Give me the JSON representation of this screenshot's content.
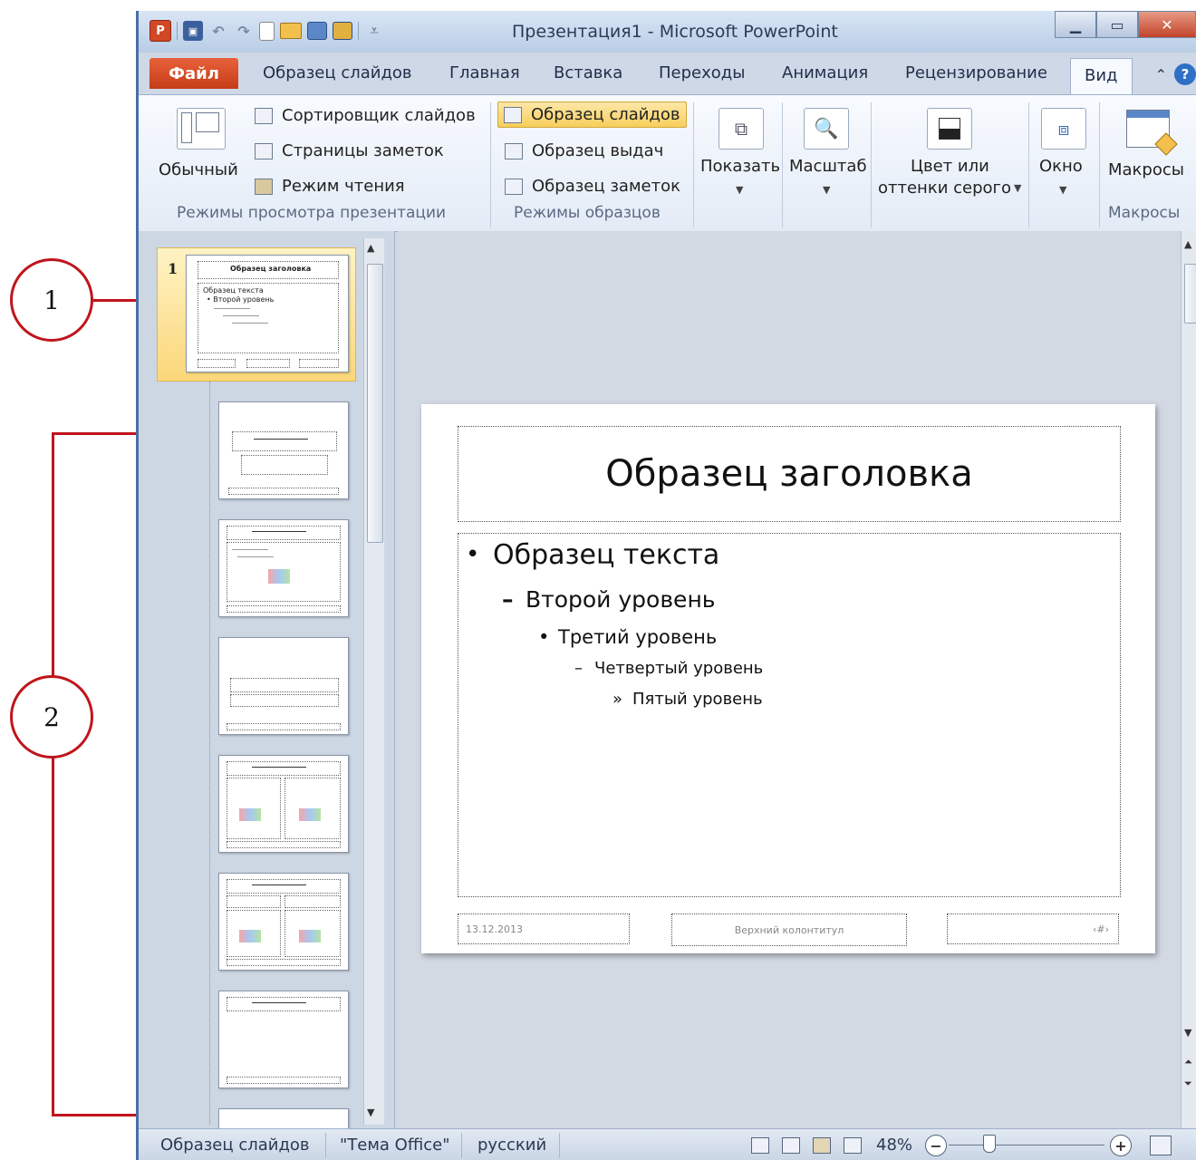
{
  "window": {
    "title": "Презентация1 - Microsoft PowerPoint",
    "app_icon_letter": "P",
    "controls": [
      "minimize-icon",
      "maximize-icon",
      "close-icon"
    ]
  },
  "ribbon_tabs": [
    "Файл",
    "Образец слайдов",
    "Главная",
    "Вставка",
    "Переходы",
    "Анимация",
    "Рецензирование",
    "Вид"
  ],
  "active_tab": "Вид",
  "ribbon": {
    "view_modes": {
      "normal": "Обычный",
      "sorter": "Сортировщик слайдов",
      "notes_pages": "Страницы заметок",
      "reading": "Режим чтения",
      "label": "Режимы просмотра презентации"
    },
    "master_views": {
      "slide_master": "Образец слайдов",
      "handout_master": "Образец выдач",
      "notes_master": "Образец заметок",
      "label": "Режимы образцов"
    },
    "show": "Показать",
    "zoom": "Масштаб",
    "color_line1": "Цвет или",
    "color_line2": "оттенки серого",
    "window_btn": "Окно",
    "macros": "Макросы",
    "macros_label": "Макросы"
  },
  "thumbnails": {
    "selected_number": "1",
    "master_title": "Образец заголовка",
    "master_body_1": "Образец текста",
    "master_body_2": "• Второй уровень"
  },
  "slide": {
    "title": "Образец заголовка",
    "levels": [
      "Образец текста",
      "Второй уровень",
      "Третий уровень",
      "Четвертый уровень",
      "Пятый уровень"
    ],
    "bullets": [
      "•",
      "–",
      "•",
      "–",
      "»"
    ],
    "footer_date": "13.12.2013",
    "footer_center": "Верхний колонтитул",
    "footer_num": "‹#›"
  },
  "status": {
    "view": "Образец слайдов",
    "theme": "\"Тема Office\"",
    "language": "русский",
    "zoom": "48%",
    "zoom_percent": 48
  },
  "callouts": [
    "1",
    "2"
  ],
  "colors": {
    "accent_file": "#c43d17",
    "callout": "#c0141c",
    "selected": "#fbd77a"
  }
}
